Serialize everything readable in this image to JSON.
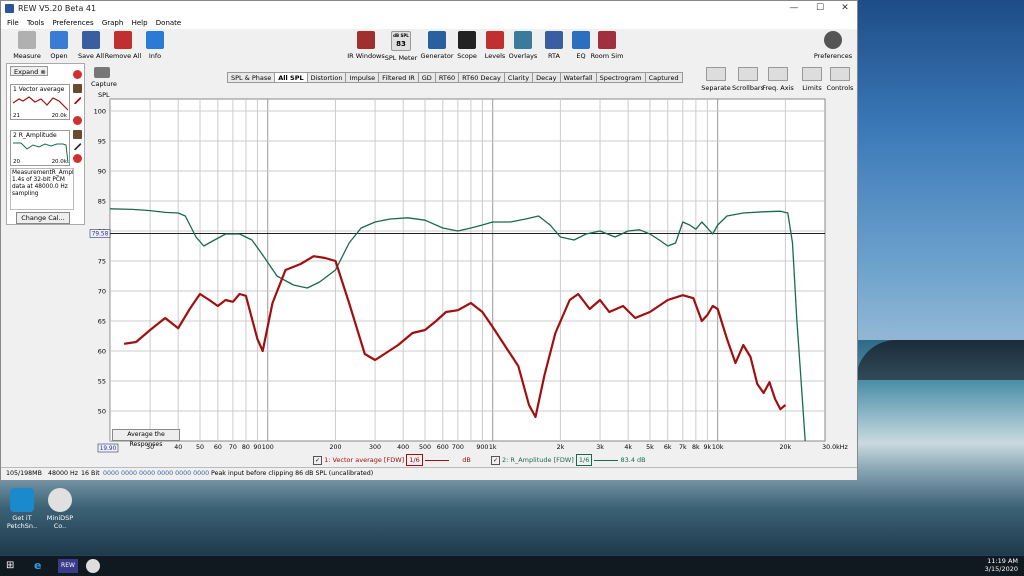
{
  "window": {
    "title": "REW V5.20 Beta 41",
    "minimize": "—",
    "maximize": "☐",
    "close": "✕"
  },
  "menu": [
    "File",
    "Tools",
    "Preferences",
    "Graph",
    "Help",
    "Donate"
  ],
  "toolbar_left": [
    {
      "label": "Measure",
      "color": "#b0b0b0"
    },
    {
      "label": "Open",
      "color": "#3a7bd5"
    },
    {
      "label": "Save All",
      "color": "#3a5fa0"
    },
    {
      "label": "Remove All",
      "color": "#c03030"
    },
    {
      "label": "Info",
      "color": "#2a7bd5"
    }
  ],
  "toolbar_right": [
    {
      "label": "IR Windows",
      "color": "#a03030"
    },
    {
      "label": "SPL Meter",
      "color": "#e0e0e0",
      "badge": "83",
      "badge_top": "dB SPL"
    },
    {
      "label": "Generator",
      "color": "#2a5fa0"
    },
    {
      "label": "Scope",
      "color": "#222222"
    },
    {
      "label": "Levels",
      "color": "#c03030"
    },
    {
      "label": "Overlays",
      "color": "#3a7a9a"
    },
    {
      "label": "RTA",
      "color": "#3a5fa0"
    },
    {
      "label": "EQ",
      "color": "#2a6fc0"
    },
    {
      "label": "Room Sim",
      "color": "#a03040"
    }
  ],
  "preferences_label": "Preferences",
  "left_panel": {
    "expand": "Expand",
    "m1": {
      "name": "1  Vector average",
      "ax_left": "21",
      "ax_right": "20.0k",
      "color": "#a01010"
    },
    "m2": {
      "name": "2  R_Amplitude",
      "ax_left": "20",
      "ax_right": "20.0k",
      "color": "#1a6a50"
    },
    "info": "MeasurementR_Amplitude.wav\n1.4s of 32-bit PCM data at 48000.0 Hz sampling",
    "change_cal": "Change Cal..."
  },
  "capture_label": "Capture",
  "tabs": [
    "SPL & Phase",
    "All SPL",
    "Distortion",
    "Impulse",
    "Filtered IR",
    "GD",
    "RT60",
    "RT60 Decay",
    "Clarity",
    "Decay",
    "Waterfall",
    "Spectrogram",
    "Captured"
  ],
  "active_tab": "All SPL",
  "right_tools": [
    "Separate",
    "Scrollbars",
    "Freq. Axis",
    "Limits",
    "Controls"
  ],
  "chart_data": {
    "type": "line",
    "ylabel": "SPL",
    "ylim": [
      45,
      102
    ],
    "xlim": [
      19.9,
      30000
    ],
    "x_scale": "log",
    "y_ticks": [
      100,
      95,
      90,
      85,
      80,
      75,
      70,
      65,
      60,
      55,
      50
    ],
    "x_ticks": [
      {
        "v": 30,
        "t": "30"
      },
      {
        "v": 40,
        "t": "40"
      },
      {
        "v": 50,
        "t": "50"
      },
      {
        "v": 60,
        "t": "60"
      },
      {
        "v": 70,
        "t": "70"
      },
      {
        "v": 80,
        "t": "80"
      },
      {
        "v": 90,
        "t": "90"
      },
      {
        "v": 100,
        "t": "100"
      },
      {
        "v": 200,
        "t": "200"
      },
      {
        "v": 300,
        "t": "300"
      },
      {
        "v": 400,
        "t": "400"
      },
      {
        "v": 500,
        "t": "500"
      },
      {
        "v": 600,
        "t": "600"
      },
      {
        "v": 700,
        "t": "700"
      },
      {
        "v": 900,
        "t": "900"
      },
      {
        "v": 1000,
        "t": "1k"
      },
      {
        "v": 2000,
        "t": "2k"
      },
      {
        "v": 3000,
        "t": "3k"
      },
      {
        "v": 4000,
        "t": "4k"
      },
      {
        "v": 5000,
        "t": "5k"
      },
      {
        "v": 6000,
        "t": "6k"
      },
      {
        "v": 7000,
        "t": "7k"
      },
      {
        "v": 8000,
        "t": "8k"
      },
      {
        "v": 9000,
        "t": "9k"
      },
      {
        "v": 10000,
        "t": "10k"
      },
      {
        "v": 20000,
        "t": "20k"
      }
    ],
    "x_min_label": "19.90",
    "x_max_label": "30.0kHz",
    "ref_line": {
      "value": 79.58,
      "label": "79.58"
    },
    "series": [
      {
        "name": "1: Vector average [FDW]",
        "color": "#a01010",
        "points": [
          [
            23,
            61.2
          ],
          [
            26,
            61.5
          ],
          [
            30,
            63.5
          ],
          [
            35,
            65.5
          ],
          [
            40,
            63.8
          ],
          [
            45,
            67
          ],
          [
            50,
            69.5
          ],
          [
            55,
            68.5
          ],
          [
            60,
            67.5
          ],
          [
            65,
            68.5
          ],
          [
            70,
            68.2
          ],
          [
            75,
            69.5
          ],
          [
            80,
            69.2
          ],
          [
            90,
            62
          ],
          [
            95,
            60
          ],
          [
            105,
            68
          ],
          [
            120,
            73.5
          ],
          [
            140,
            74.5
          ],
          [
            160,
            75.8
          ],
          [
            180,
            75.5
          ],
          [
            200,
            75
          ],
          [
            230,
            68
          ],
          [
            270,
            59.5
          ],
          [
            300,
            58.5
          ],
          [
            330,
            59.5
          ],
          [
            380,
            61
          ],
          [
            440,
            63
          ],
          [
            500,
            63.5
          ],
          [
            560,
            65
          ],
          [
            620,
            66.5
          ],
          [
            700,
            66.8
          ],
          [
            800,
            68
          ],
          [
            900,
            66.5
          ],
          [
            1000,
            64
          ],
          [
            1150,
            60.5
          ],
          [
            1300,
            57.5
          ],
          [
            1450,
            51
          ],
          [
            1550,
            49
          ],
          [
            1700,
            56
          ],
          [
            1900,
            63
          ],
          [
            2200,
            68.5
          ],
          [
            2400,
            69.5
          ],
          [
            2700,
            67
          ],
          [
            3000,
            68.5
          ],
          [
            3300,
            66.5
          ],
          [
            3800,
            67.5
          ],
          [
            4300,
            65.5
          ],
          [
            5000,
            66.5
          ],
          [
            6000,
            68.5
          ],
          [
            7000,
            69.3
          ],
          [
            7800,
            68.8
          ],
          [
            8500,
            65
          ],
          [
            9000,
            66
          ],
          [
            9500,
            67.5
          ],
          [
            10000,
            67
          ],
          [
            11000,
            62
          ],
          [
            12000,
            58
          ],
          [
            13000,
            61
          ],
          [
            14000,
            59
          ],
          [
            15000,
            54.5
          ],
          [
            16000,
            53
          ],
          [
            17000,
            54.8
          ],
          [
            18000,
            52
          ],
          [
            19000,
            50.3
          ],
          [
            20000,
            51
          ]
        ]
      },
      {
        "name": "2: R_Amplitude [FDW]",
        "color": "#1a6a50",
        "points": [
          [
            19.9,
            83.7
          ],
          [
            25,
            83.6
          ],
          [
            30,
            83.4
          ],
          [
            35,
            83.1
          ],
          [
            40,
            83
          ],
          [
            43,
            82.5
          ],
          [
            48,
            79
          ],
          [
            52,
            77.5
          ],
          [
            58,
            78.5
          ],
          [
            65,
            79.5
          ],
          [
            75,
            79.5
          ],
          [
            85,
            78.5
          ],
          [
            95,
            76
          ],
          [
            110,
            72.5
          ],
          [
            130,
            71
          ],
          [
            150,
            70.5
          ],
          [
            170,
            71.5
          ],
          [
            200,
            73.5
          ],
          [
            230,
            78
          ],
          [
            260,
            80.5
          ],
          [
            300,
            81.5
          ],
          [
            350,
            82
          ],
          [
            420,
            82.2
          ],
          [
            500,
            81.8
          ],
          [
            600,
            80.5
          ],
          [
            700,
            80
          ],
          [
            800,
            80.5
          ],
          [
            900,
            81
          ],
          [
            1000,
            81.5
          ],
          [
            1200,
            81.5
          ],
          [
            1400,
            82
          ],
          [
            1600,
            82.5
          ],
          [
            1800,
            81
          ],
          [
            2000,
            79
          ],
          [
            2300,
            78.5
          ],
          [
            2600,
            79.5
          ],
          [
            3000,
            80
          ],
          [
            3500,
            79
          ],
          [
            4000,
            80
          ],
          [
            4500,
            80.2
          ],
          [
            5000,
            79.5
          ],
          [
            5500,
            78.5
          ],
          [
            6000,
            77.5
          ],
          [
            6500,
            78
          ],
          [
            7000,
            81.5
          ],
          [
            7500,
            81
          ],
          [
            8000,
            80.3
          ],
          [
            8500,
            81.5
          ],
          [
            9000,
            80.5
          ],
          [
            9500,
            79.5
          ],
          [
            10000,
            81
          ],
          [
            11000,
            82.5
          ],
          [
            13000,
            83
          ],
          [
            16000,
            83.2
          ],
          [
            19000,
            83.3
          ],
          [
            20500,
            83
          ],
          [
            21500,
            78
          ],
          [
            22500,
            65
          ],
          [
            23500,
            55
          ],
          [
            24500,
            45
          ]
        ]
      }
    ]
  },
  "legend": {
    "s1_label": "1: Vector average [FDW]",
    "s1_smooth": "1/6",
    "s1_value": "dB",
    "s2_label": "2: R_Amplitude [FDW]",
    "s2_smooth": "1/6",
    "s2_value": "83.4 dB"
  },
  "avg_button": "Average the Responses",
  "status": {
    "mem": "105/198MB",
    "rate": "48000 Hz",
    "bits": "16 Bit",
    "counter": "0000 0000  0000 0000  0000 0000",
    "msg": "Peak input before clipping 86 dB SPL (uncalibrated)"
  },
  "desktop_icons": [
    {
      "label": "Get iT PetchSn..",
      "color": "#1a8acd"
    },
    {
      "label": "MiniDSP Co..",
      "color": "#e0e0e0"
    }
  ],
  "taskbar": {
    "time": "11:19 AM",
    "date": "3/15/2020",
    "app_label": "REW"
  }
}
